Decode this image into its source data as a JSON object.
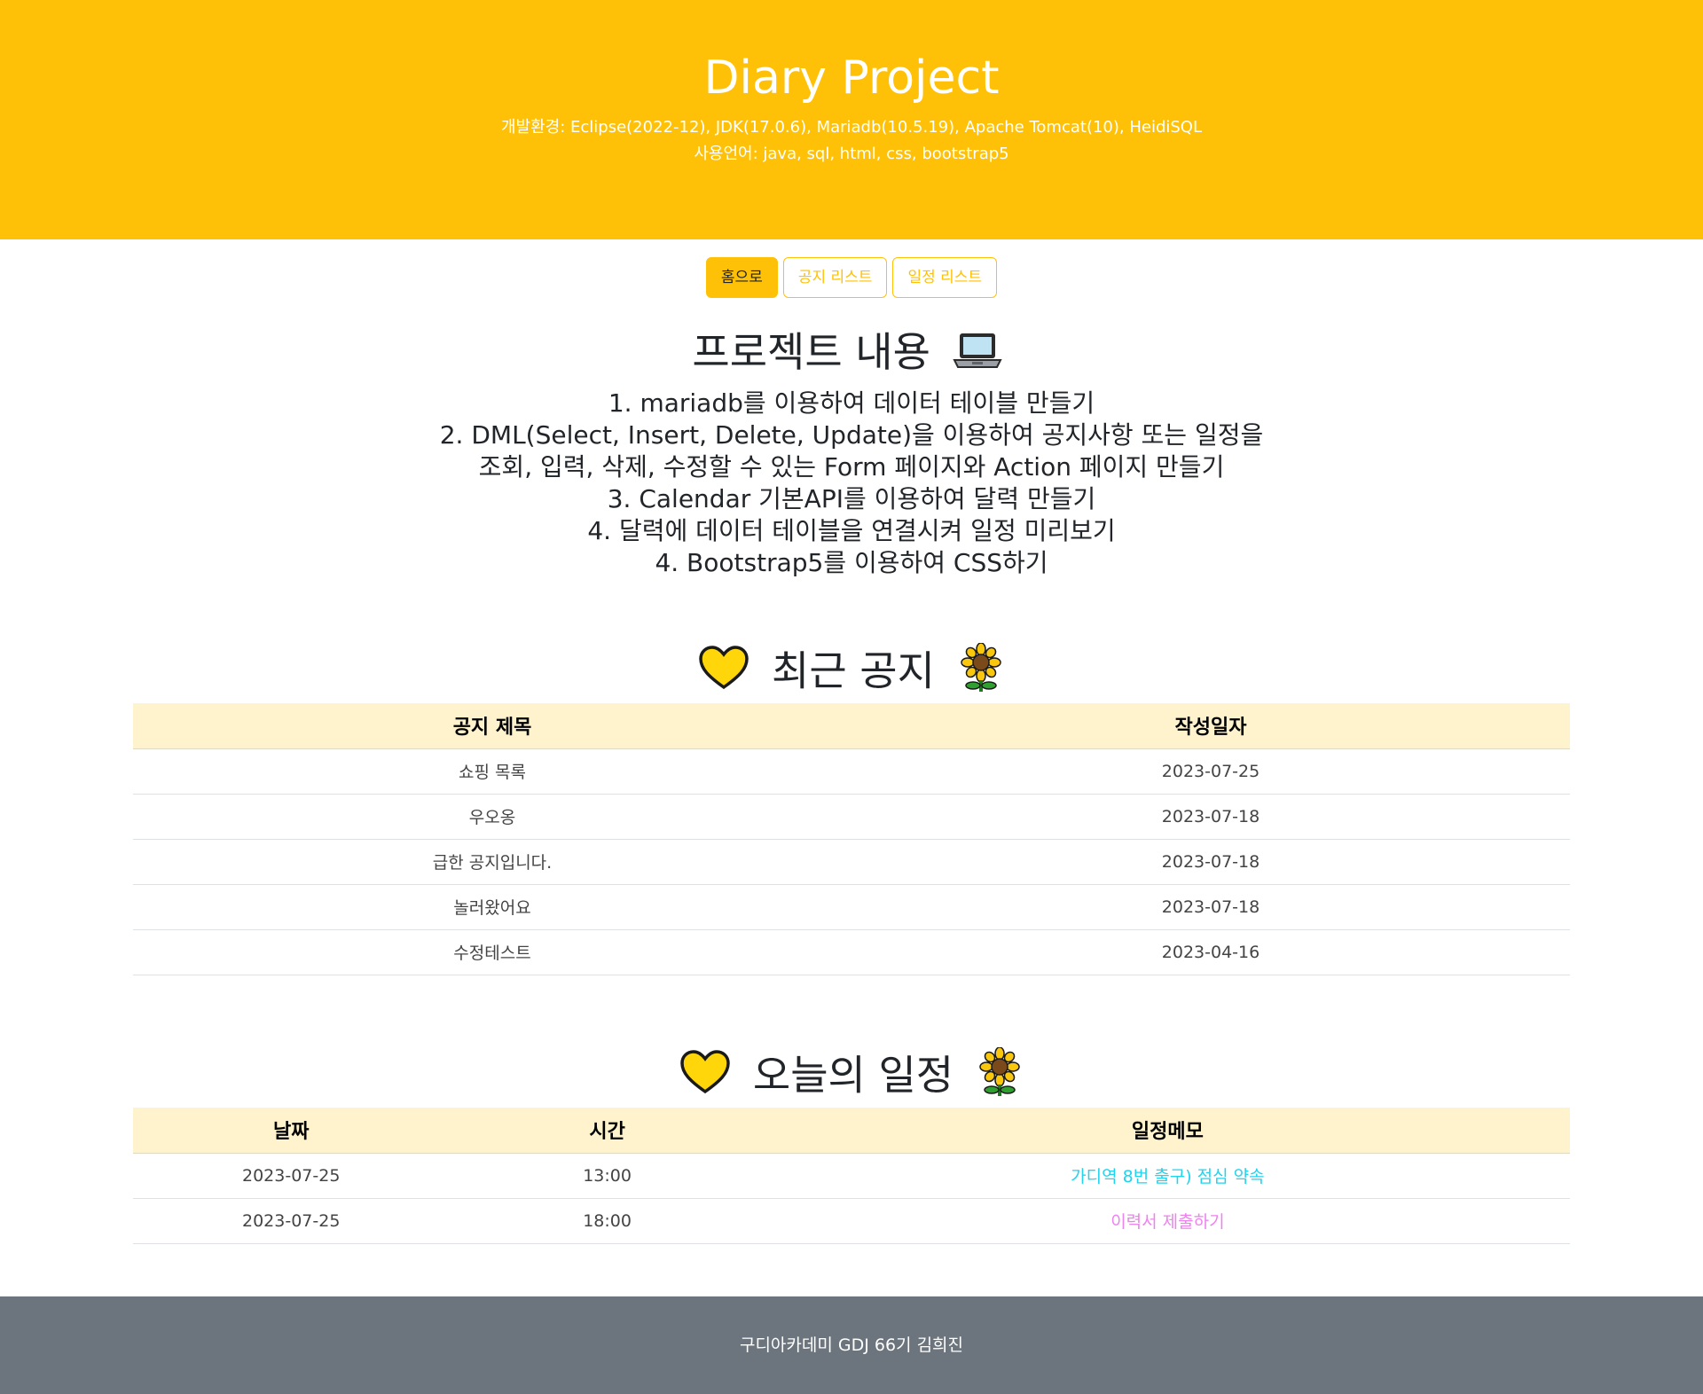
{
  "header": {
    "title": "Diary Project",
    "environment": "개발환경: Eclipse(2022-12), JDK(17.0.6), Mariadb(10.5.19), Apache Tomcat(10), HeidiSQL",
    "languages": "사용언어: java, sql, html, css, bootstrap5",
    "background_color": "#ffc107"
  },
  "nav": {
    "home": "홈으로",
    "notice_list": "공지 리스트",
    "schedule_list": "일정 리스트"
  },
  "project": {
    "title": "프로젝트 내용",
    "icon": "laptop-icon",
    "items": [
      "1. mariadb를 이용하여 데이터 테이블 만들기",
      "2. DML(Select, Insert, Delete, Update)을 이용하여 공지사항 또는 일정을",
      "조회, 입력, 삭제, 수정할 수 있는 Form 페이지와 Action 페이지 만들기",
      "3. Calendar 기본API를 이용하여 달력 만들기",
      "4. 달력에 데이터 테이블을 연결시켜 일정 미리보기",
      "4. Bootstrap5를 이용하여 CSS하기"
    ]
  },
  "notices": {
    "title": "최근 공지",
    "icons": [
      "yellow-heart-icon",
      "sunflower-icon"
    ],
    "columns": [
      "공지 제목",
      "작성일자"
    ],
    "rows": [
      {
        "title": "쇼핑 목록",
        "date": "2023-07-25"
      },
      {
        "title": "우오옹",
        "date": "2023-07-18"
      },
      {
        "title": "급한 공지입니다.",
        "date": "2023-07-18"
      },
      {
        "title": "놀러왔어요",
        "date": "2023-07-18"
      },
      {
        "title": "수정테스트",
        "date": "2023-04-16"
      }
    ]
  },
  "schedule": {
    "title": "오늘의 일정",
    "icons": [
      "yellow-heart-icon",
      "sunflower-icon"
    ],
    "columns": [
      "날짜",
      "시간",
      "일정메모"
    ],
    "rows": [
      {
        "date": "2023-07-25",
        "time": "13:00",
        "memo": "가디역 8번 출구) 점심 약속",
        "memo_color": "#22d3ee"
      },
      {
        "date": "2023-07-25",
        "time": "18:00",
        "memo": "이력서 제출하기",
        "memo_color": "#ee82ee"
      }
    ]
  },
  "footer": {
    "text": "구디아카데미 GDJ 66기 김희진",
    "background_color": "#6c757d"
  }
}
